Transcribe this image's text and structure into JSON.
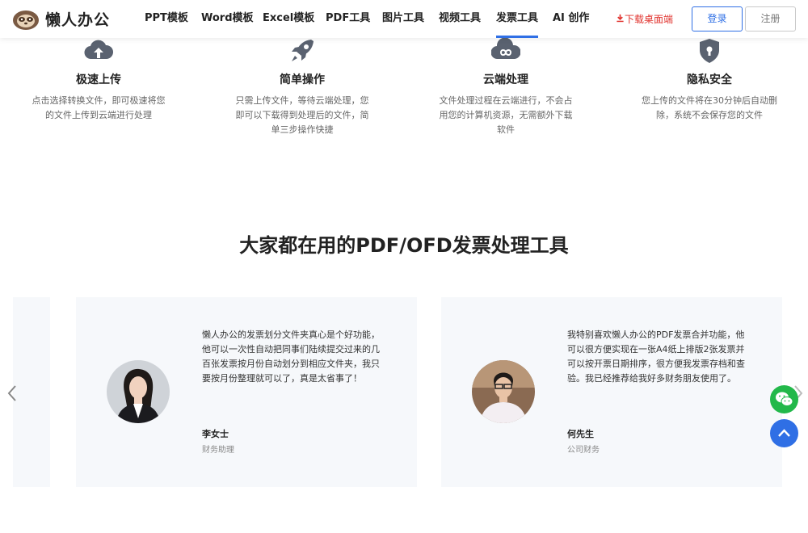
{
  "header": {
    "logo_text": "懒人办公",
    "nav": [
      "PPT模板",
      "Word模板",
      "Excel模板",
      "PDF工具",
      "图片工具",
      "视频工具",
      "发票工具",
      "AI 创作"
    ],
    "active_nav_index": 6,
    "download_label": "下载桌面端",
    "login_label": "登录",
    "register_label": "注册"
  },
  "features": [
    {
      "icon": "cloud-upload-icon",
      "title": "极速上传",
      "desc": "点击选择转换文件，即可极速将您的文件上传到云端进行处理"
    },
    {
      "icon": "rocket-icon",
      "title": "简单操作",
      "desc": "只需上传文件，等待云端处理，您即可以下载得到处理后的文件，简单三步操作快捷"
    },
    {
      "icon": "cloud-infinity-icon",
      "title": "云端处理",
      "desc": "文件处理过程在云端进行，不会占用您的计算机资源，无需额外下载软件"
    },
    {
      "icon": "shield-lock-icon",
      "title": "隐私安全",
      "desc": "您上传的文件将在30分钟后自动删除，系统不会保存您的文件"
    }
  ],
  "section_title": "大家都在用的PDF/OFD发票处理工具",
  "testimonials": [
    {
      "quote": "懒人办公的发票划分文件夹真心是个好功能，他可以一次性自动把同事们陆续提交过来的几百张发票按月份自动划分到相应文件夹，我只要按月份整理就可以了，真是太省事了！",
      "name": "李女士",
      "role": "财务助理"
    },
    {
      "quote": "我特别喜欢懒人办公的PDF发票合并功能，他可以很方便实现在一张A4纸上排版2张发票并可以按开票日期排序，很方便我发票存档和查验。我已经推荐给我好多财务朋友使用了。",
      "name": "何先生",
      "role": "公司财务"
    }
  ],
  "colors": {
    "accent": "#2f6fe5",
    "download": "#e0322d",
    "wechat": "#22b84a",
    "icon": "#5a6270"
  }
}
